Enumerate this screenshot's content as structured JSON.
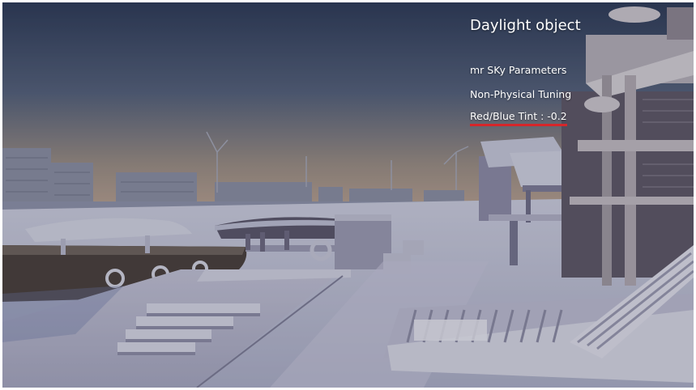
{
  "overlay": {
    "title": "Daylight object",
    "sky_section": "mr SKy Parameters",
    "tuning_section": "Non-Physical Tuning",
    "tint_label": "Red/Blue Tint : -0.2"
  },
  "colors": {
    "highlight_underline": "#d6262a",
    "text": "#ffffff"
  }
}
